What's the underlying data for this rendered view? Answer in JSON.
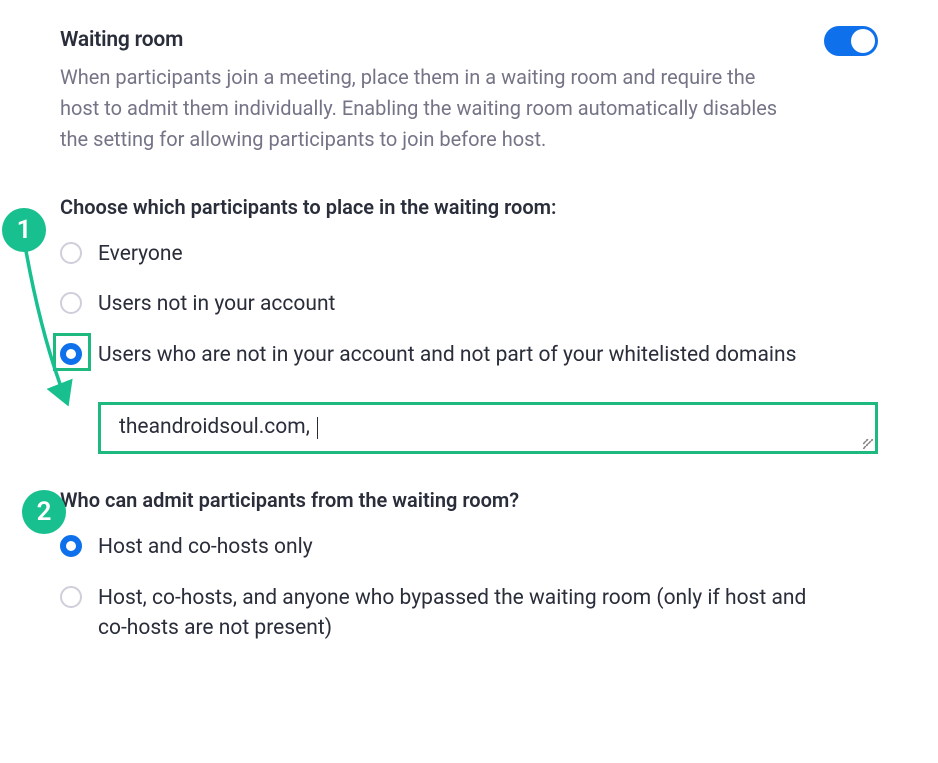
{
  "setting": {
    "title": "Waiting room",
    "description": "When participants join a meeting, place them in a waiting room and require the host to admit them individually. Enabling the waiting room automatically disables the setting for allowing participants to join before host.",
    "toggle_on": true
  },
  "participants_section": {
    "title": "Choose which participants to place in the waiting room:",
    "options": [
      {
        "label": "Everyone",
        "selected": false
      },
      {
        "label": "Users not in your account",
        "selected": false
      },
      {
        "label": "Users who are not in your account and not part of your whitelisted domains",
        "selected": true
      }
    ],
    "domain_input_value": "theandroidsoul.com, "
  },
  "admit_section": {
    "title": "Who can admit participants from the waiting room?",
    "options": [
      {
        "label": "Host and co-hosts only",
        "selected": true
      },
      {
        "label": "Host, co-hosts, and anyone who bypassed the waiting room (only if host and co-hosts are not present)",
        "selected": false
      }
    ]
  },
  "annotations": {
    "badge1": "1",
    "badge2": "2"
  }
}
